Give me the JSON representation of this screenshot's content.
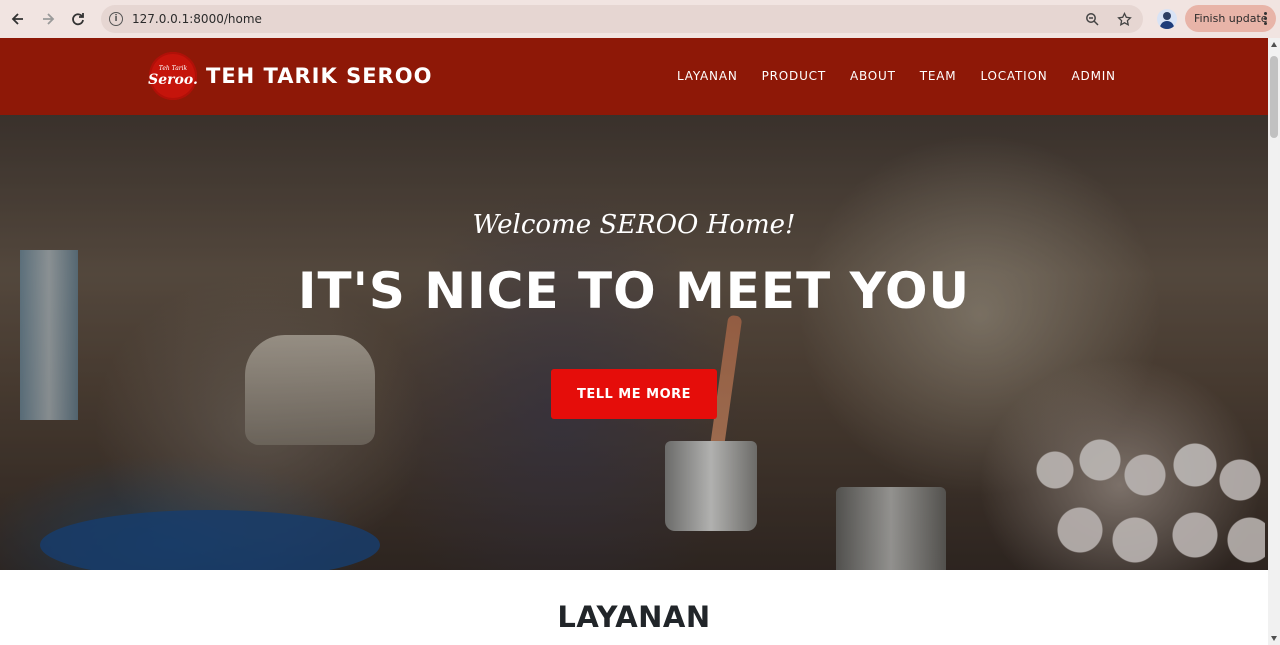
{
  "browser": {
    "url": "127.0.0.1:8000/home",
    "finish_update_label": "Finish update"
  },
  "navbar": {
    "logo_small": "Teh Tarik",
    "logo_main": "Seroo.",
    "brand": "TEH TARIK SEROO",
    "menu": [
      "LAYANAN",
      "PRODUCT",
      "ABOUT",
      "TEAM",
      "LOCATION",
      "ADMIN"
    ]
  },
  "hero": {
    "subheading": "Welcome SEROO Home!",
    "heading": "IT'S NICE TO MEET YOU",
    "cta_label": "TELL ME MORE"
  },
  "sections": {
    "services_title": "LAYANAN"
  },
  "colors": {
    "navbar": "#8e1807",
    "cta": "#e50d0a",
    "logo": "#c5140b"
  },
  "icons": [
    "back-arrow-icon",
    "forward-arrow-icon",
    "reload-icon",
    "info-icon",
    "zoom-icon",
    "star-icon",
    "kebab-menu-icon"
  ]
}
